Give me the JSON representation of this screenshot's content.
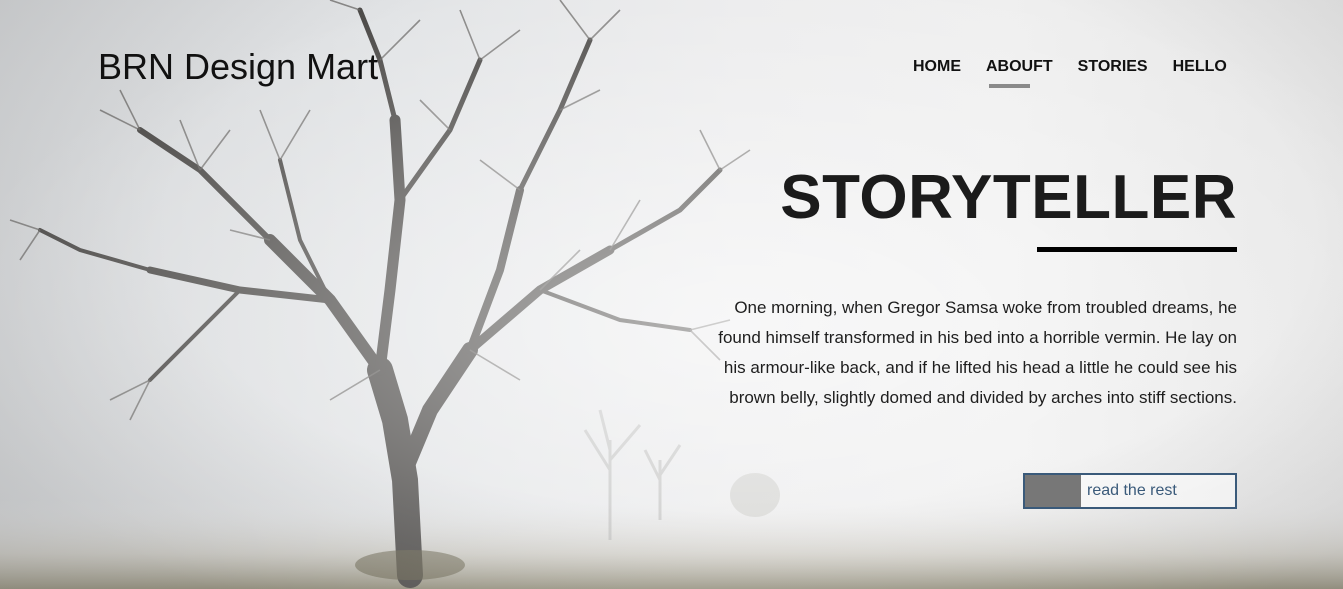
{
  "brand": {
    "name": "BRN Design Mart"
  },
  "nav": {
    "items": [
      {
        "label": "HOME",
        "active": false
      },
      {
        "label": "ABOUFT",
        "active": true
      },
      {
        "label": "STORIES",
        "active": false
      },
      {
        "label": "HELLO",
        "active": false
      }
    ]
  },
  "hero": {
    "headline": "STORYTELLER",
    "paragraph": "One morning, when Gregor Samsa woke from troubled dreams, he found himself transformed in his bed into a horrible vermin. He lay on his armour-like back, and if he lifted his head a little he could see his brown belly, slightly domed and divided by arches into stiff sections.",
    "cta_label": "read the rest"
  },
  "colors": {
    "accent_border": "#3a5a7a",
    "nav_underline": "#8a8a8a",
    "headline_rule": "#000000"
  },
  "icons": [
    "tree-image"
  ]
}
